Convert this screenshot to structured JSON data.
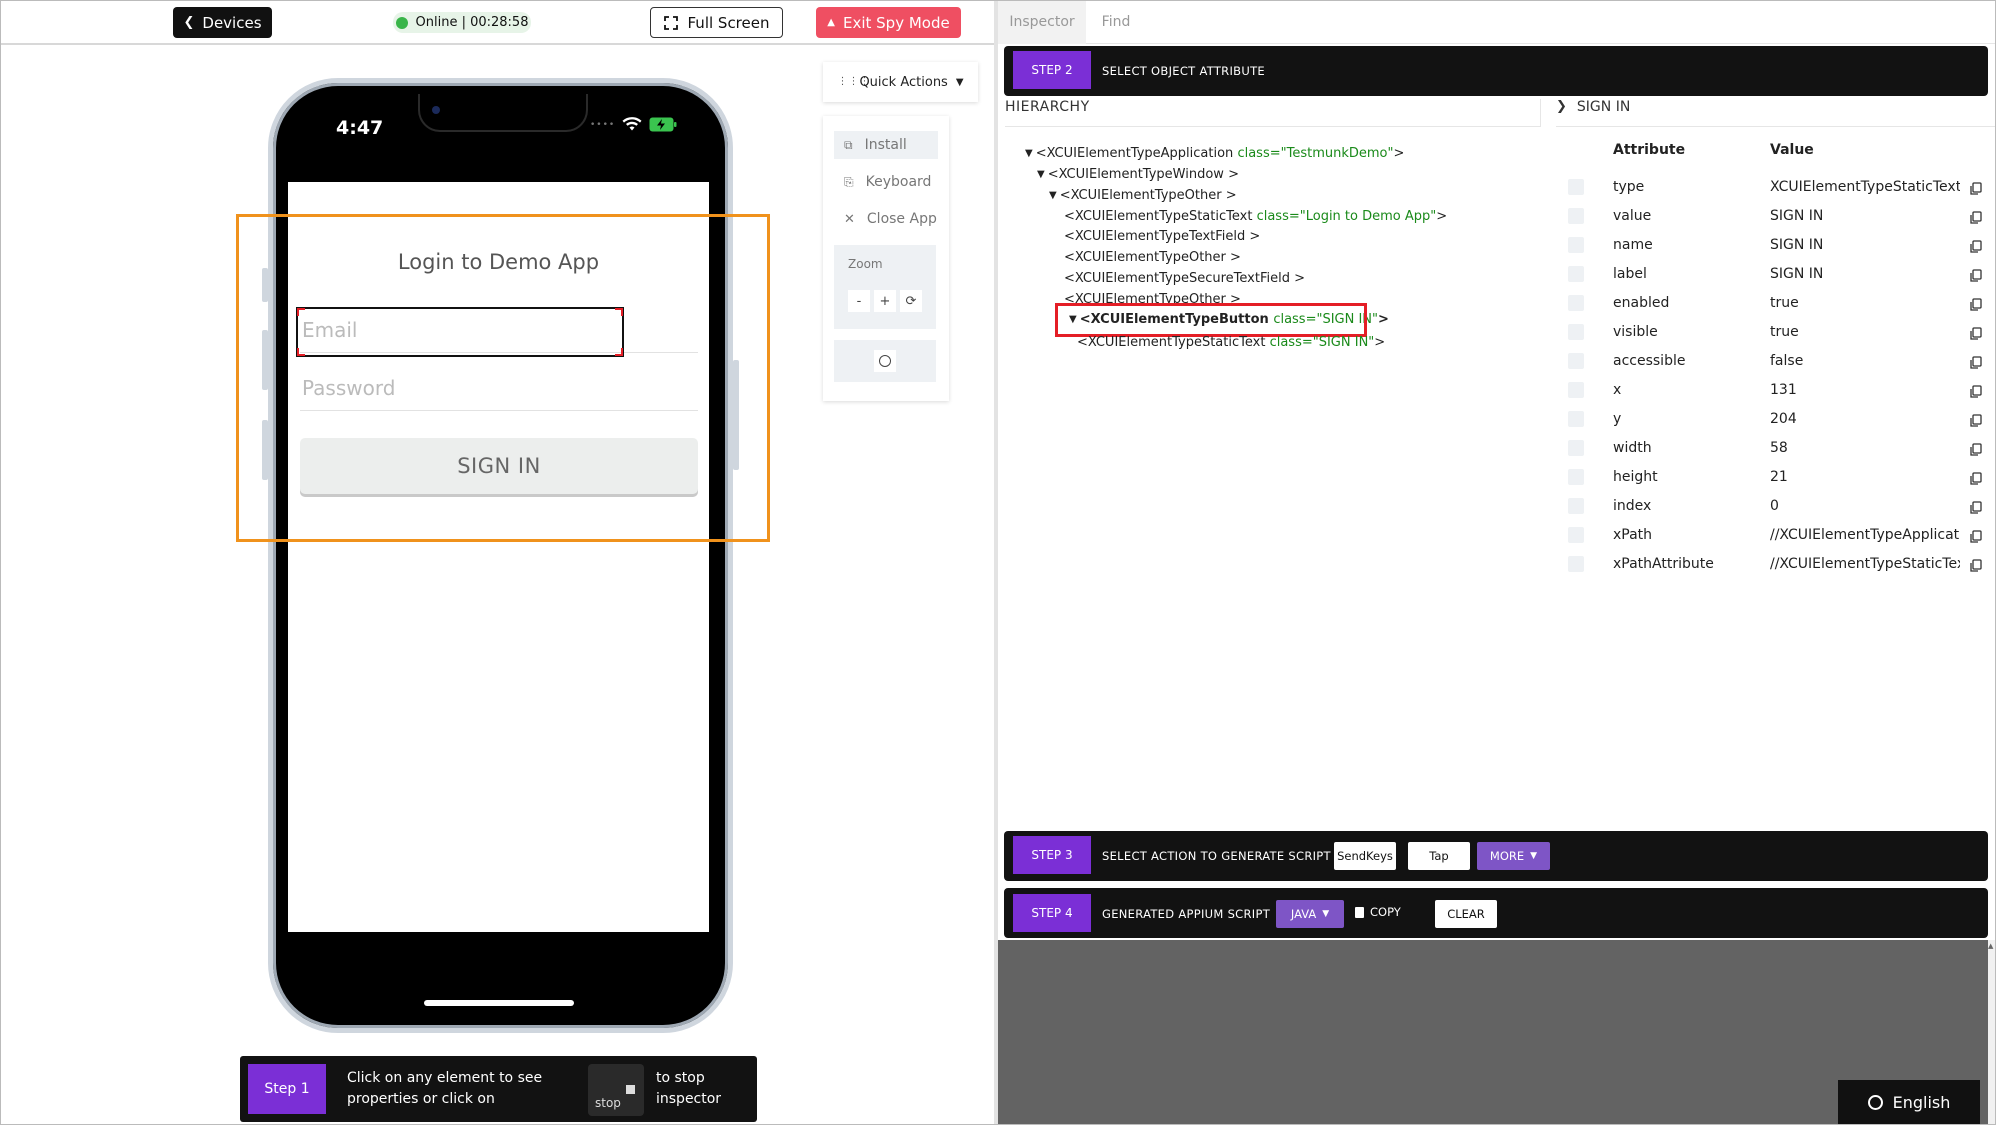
{
  "topbar": {
    "devices_label": "Devices",
    "status_text": "Online | 00:28:58",
    "fullscreen_label": "Full Screen",
    "exit_label": "Exit Spy Mode"
  },
  "phone": {
    "time": "4:47",
    "app_title": "Login to Demo App",
    "email_placeholder": "Email",
    "password_placeholder": "Password",
    "signin_label": "SIGN IN"
  },
  "quick_actions": {
    "label": "Quick Actions",
    "items": [
      "Install",
      "Keyboard",
      "Close App"
    ],
    "zoom_label": "Zoom",
    "zoom_out": "-",
    "zoom_in": "+"
  },
  "step1": {
    "badge": "Step 1",
    "text_left": "Click on any element to see properties or click on",
    "stop_label": "stop",
    "text_right": "to stop inspector"
  },
  "tabs": [
    "Inspector",
    "Find"
  ],
  "step2": {
    "badge": "STEP 2",
    "label": "SELECT OBJECT ATTRIBUTE"
  },
  "hierarchy": {
    "header": "HIERARCHY",
    "nodes": [
      {
        "tag": "<XCUIElementTypeApplication",
        "cls": "class=\"TestmunkDemo\"",
        "end": ">"
      },
      {
        "tag": "<XCUIElementTypeWindow",
        "cls": "",
        "end": ">"
      },
      {
        "tag": "<XCUIElementTypeOther",
        "cls": "",
        "end": ">"
      },
      {
        "tag": "<XCUIElementTypeStaticText",
        "cls": "class=\"Login to Demo App\"",
        "end": ">"
      },
      {
        "tag": "<XCUIElementTypeTextField",
        "cls": "",
        "end": ">"
      },
      {
        "tag": "<XCUIElementTypeOther",
        "cls": "",
        "end": ">"
      },
      {
        "tag": "<XCUIElementTypeSecureTextField",
        "cls": "",
        "end": ">"
      },
      {
        "tag": "<XCUIElementTypeOther",
        "cls": "",
        "end": ">"
      },
      {
        "tag": "<XCUIElementTypeButton",
        "cls": "class=\"SIGN IN\"",
        "end": ">"
      },
      {
        "tag": "<XCUIElementTypeStaticText",
        "cls": "class=\"SIGN IN\"",
        "end": ">"
      }
    ]
  },
  "attributes": {
    "title": "SIGN IN",
    "col_attribute": "Attribute",
    "col_value": "Value",
    "rows": [
      {
        "name": "type",
        "value": "XCUIElementTypeStaticText"
      },
      {
        "name": "value",
        "value": "SIGN IN"
      },
      {
        "name": "name",
        "value": "SIGN IN"
      },
      {
        "name": "label",
        "value": "SIGN IN"
      },
      {
        "name": "enabled",
        "value": "true"
      },
      {
        "name": "visible",
        "value": "true"
      },
      {
        "name": "accessible",
        "value": "false"
      },
      {
        "name": "x",
        "value": "131"
      },
      {
        "name": "y",
        "value": "204"
      },
      {
        "name": "width",
        "value": "58"
      },
      {
        "name": "height",
        "value": "21"
      },
      {
        "name": "index",
        "value": "0"
      },
      {
        "name": "xPath",
        "value": "//XCUIElementTypeApplicati..."
      },
      {
        "name": "xPathAttribute",
        "value": "//XCUIElementTypeStaticText..."
      }
    ]
  },
  "step3": {
    "badge": "STEP 3",
    "label": "SELECT ACTION TO GENERATE SCRIPT",
    "sendkeys": "SendKeys",
    "tap": "Tap",
    "more": "MORE"
  },
  "step4": {
    "badge": "STEP 4",
    "label": "GENERATED APPIUM SCRIPT",
    "lang": "JAVA",
    "copy": "COPY",
    "clear": "CLEAR"
  },
  "language_button": "English",
  "colors": {
    "accent_purple": "#7b2fd6",
    "exit_red": "#ef4f62",
    "highlight_orange": "#f0921c",
    "selection_red": "#e41e26",
    "online_green": "#3ab54a"
  }
}
